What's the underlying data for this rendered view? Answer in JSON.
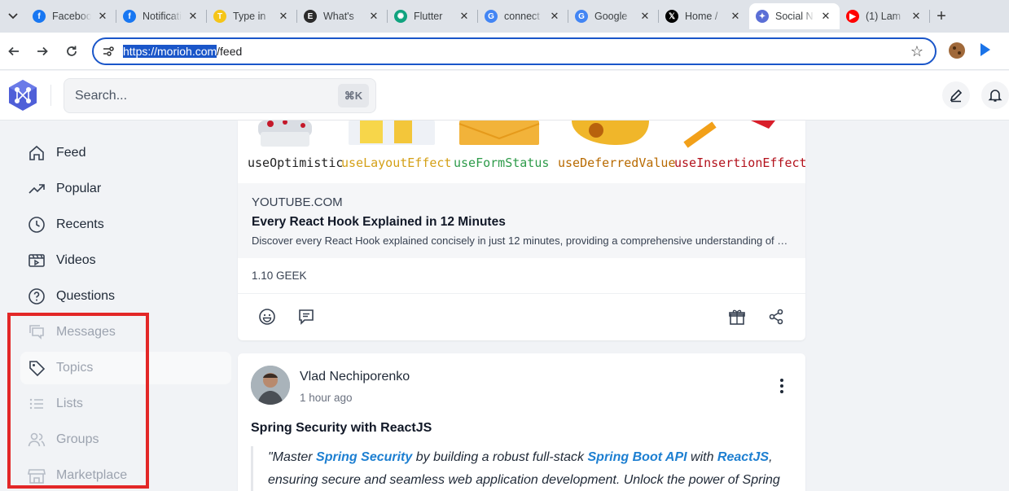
{
  "browser": {
    "tabs": [
      {
        "title": "Facebook",
        "icon": "facebook-icon",
        "color": "#1877f2",
        "glyph": "f"
      },
      {
        "title": "Notifications",
        "icon": "facebook-icon",
        "color": "#1877f2",
        "glyph": "f"
      },
      {
        "title": "Type in",
        "icon": "type-in-icon",
        "color": "#f5c518",
        "glyph": "T"
      },
      {
        "title": "What's",
        "icon": "ek-icon",
        "color": "#2b2b2b",
        "glyph": "E"
      },
      {
        "title": "Flutter",
        "icon": "chatgpt-icon",
        "color": "#10a37f",
        "glyph": "✺"
      },
      {
        "title": "connect",
        "icon": "google-icon",
        "color": "#4285f4",
        "glyph": "G"
      },
      {
        "title": "Google",
        "icon": "google-translate-icon",
        "color": "#4285f4",
        "glyph": "G"
      },
      {
        "title": "Home /",
        "icon": "x-icon",
        "color": "#000000",
        "glyph": "𝕏"
      },
      {
        "title": "Social N",
        "icon": "morioh-icon",
        "color": "#5b6fd6",
        "glyph": "✦"
      },
      {
        "title": "(1) Lam",
        "icon": "youtube-icon",
        "color": "#ff0000",
        "glyph": "▶"
      }
    ],
    "active_tab_index": 8,
    "url_selected": "https://morioh.com",
    "url_rest": "/feed"
  },
  "header": {
    "search_placeholder": "Search...",
    "shortcut": "⌘K"
  },
  "sidebar": {
    "items": [
      {
        "label": "Feed",
        "name": "feed",
        "icon": "home-icon"
      },
      {
        "label": "Popular",
        "name": "popular",
        "icon": "trending-icon"
      },
      {
        "label": "Recents",
        "name": "recents",
        "icon": "clock-icon"
      },
      {
        "label": "Videos",
        "name": "videos",
        "icon": "film-icon"
      },
      {
        "label": "Questions",
        "name": "questions",
        "icon": "question-icon"
      },
      {
        "label": "Messages",
        "name": "messages",
        "icon": "chat-icon"
      },
      {
        "label": "Topics",
        "name": "topics",
        "icon": "tag-icon"
      },
      {
        "label": "Lists",
        "name": "lists",
        "icon": "list-icon"
      },
      {
        "label": "Groups",
        "name": "groups",
        "icon": "users-icon"
      },
      {
        "label": "Marketplace",
        "name": "marketplace",
        "icon": "store-icon"
      }
    ]
  },
  "post1": {
    "hooks": [
      {
        "label": "useOptimistic",
        "color": "#222222"
      },
      {
        "label": "useLayoutEffect",
        "color": "#d4a017"
      },
      {
        "label": "useFormStatus",
        "color": "#2e9b4a"
      },
      {
        "label": "useDeferredValue",
        "color": "#b86a00"
      },
      {
        "label": "useInsertionEffect",
        "color": "#b3121c"
      }
    ],
    "domain": "YOUTUBE.COM",
    "title": "Every React Hook Explained in 12 Minutes",
    "description": "Discover every React Hook explained concisely in just 12 minutes, providing a comprehensive understanding of each hook and its use cases.",
    "tag": "1.10 GEEK"
  },
  "post2": {
    "author": "Vlad Nechiporenko",
    "time": "1 hour ago",
    "title": "Spring Security with ReactJS",
    "quote_open": "\"Master ",
    "link1": "Spring Security",
    "text1": " by building a robust full-stack ",
    "link2": "Spring Boot API",
    "text2": " with ",
    "link3": "ReactJS",
    "text3": ", ensuring secure and seamless web application development. Unlock the power of Spring"
  }
}
